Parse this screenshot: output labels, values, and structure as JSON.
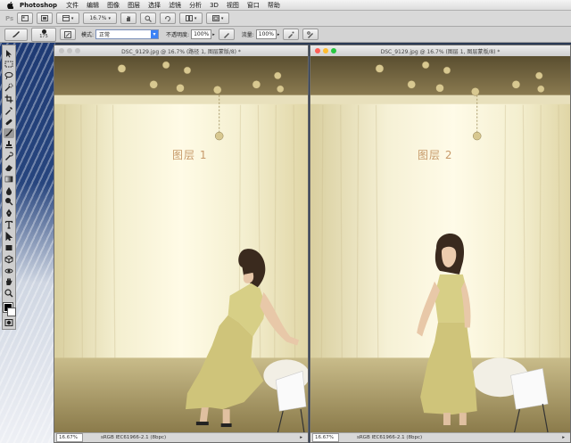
{
  "menubar": {
    "app_name": "Photoshop",
    "items": [
      "文件",
      "编辑",
      "图像",
      "图层",
      "选择",
      "滤镜",
      "分析",
      "3D",
      "视图",
      "窗口",
      "帮助"
    ]
  },
  "options_bar_top": {
    "ps_label": "Ps",
    "zoom_value": "16.7%"
  },
  "options_bar_brush": {
    "brush_size": "175",
    "mode_label": "模式:",
    "mode_value": "正常",
    "opacity_label": "不透明度:",
    "opacity_value": "100%",
    "flow_label": "流量:",
    "flow_value": "100%"
  },
  "documents": [
    {
      "title": "DSC_9129.jpg @ 16.7% (路径 1, 图层蒙版/8) *",
      "layer_label": "图层 1",
      "zoom": "16.67%",
      "profile": "sRGB IEC61966-2.1 (8bpc)",
      "active": false
    },
    {
      "title": "DSC_9129.jpg @ 16.7% (图层 1, 图层蒙版/8) *",
      "layer_label": "图层 2",
      "zoom": "16.67%",
      "profile": "sRGB IEC61966-2.1 (8bpc)",
      "active": true
    }
  ],
  "colors": {
    "traffic_red": "#ff5f57",
    "traffic_yellow": "#febc2e",
    "traffic_green": "#28c840",
    "inactive_light": "#c4c4c4"
  },
  "tools": [
    "move-icon",
    "marquee-icon",
    "lasso-icon",
    "quick-select-icon",
    "crop-icon",
    "eyedropper-icon",
    "healing-icon",
    "brush-icon",
    "clone-stamp-icon",
    "history-brush-icon",
    "eraser-icon",
    "gradient-icon",
    "blur-icon",
    "dodge-icon",
    "pen-icon",
    "type-icon",
    "path-select-icon",
    "shape-icon",
    "3d-rotate-icon",
    "3d-orbit-icon",
    "hand-icon",
    "zoom-icon"
  ]
}
